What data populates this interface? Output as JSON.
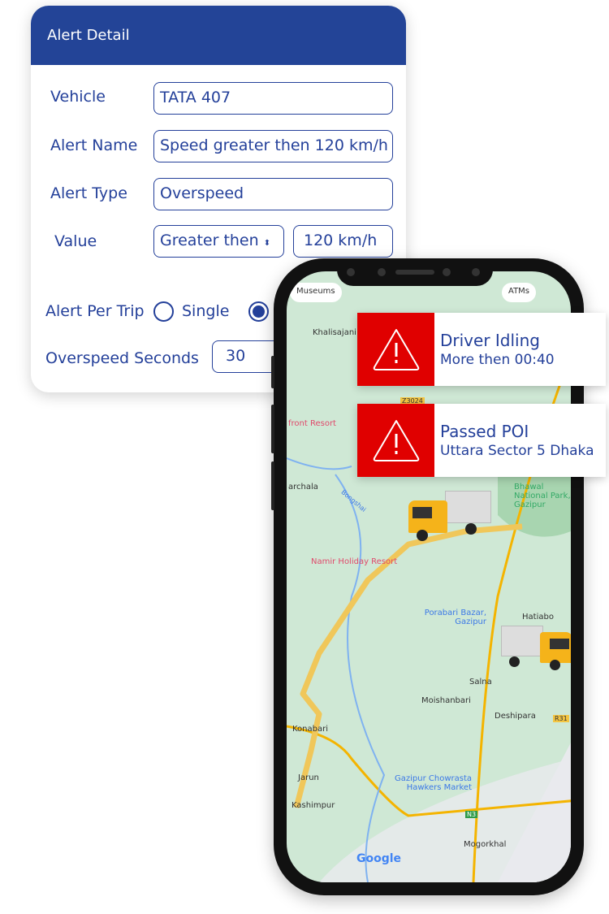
{
  "card": {
    "title": "Alert Detail",
    "fields": {
      "vehicle": {
        "label": "Vehicle",
        "value": "TATA 407"
      },
      "alert_name": {
        "label": "Alert Name",
        "value": "Speed greater then 120 km/h"
      },
      "alert_type": {
        "label": "Alert Type",
        "value": "Overspeed"
      },
      "value": {
        "label": "Value",
        "operator": "Greater then",
        "amount": "120 km/h"
      },
      "alert_per_trip": {
        "label": "Alert Per Trip",
        "option_single": "Single",
        "selected": "second option"
      },
      "overspeed_seconds": {
        "label": "Overspeed Seconds",
        "value": "30"
      }
    },
    "accent": "#234497"
  },
  "map": {
    "chips": [
      "Museums",
      "ATMs"
    ],
    "labels": [
      "Khalisajani",
      "front Resort",
      "archala",
      "Namir Holiday Resort",
      "Porabari Bazar, Gazipur",
      "Hatiabo",
      "Salna",
      "Moishanbari",
      "Deshipara",
      "Konabari",
      "Jarun",
      "Kashimpur",
      "Gazipur Chowrasta Hawkers Market",
      "Mogorkhal",
      "Bhawal National Park, Gazipur",
      "Z3024",
      "R31",
      "N3",
      "Bongshai"
    ],
    "logo": "Google"
  },
  "alerts": [
    {
      "title": "Driver Idling",
      "detail": "More then 00:40",
      "icon": "warning-triangle-icon"
    },
    {
      "title": "Passed POI",
      "detail": "Uttara Sector 5 Dhaka",
      "icon": "warning-triangle-icon"
    }
  ],
  "colors": {
    "alert_red": "#e00000",
    "text_blue": "#24409a",
    "route": "#f0c75a",
    "map_green": "#cfe8d5"
  }
}
